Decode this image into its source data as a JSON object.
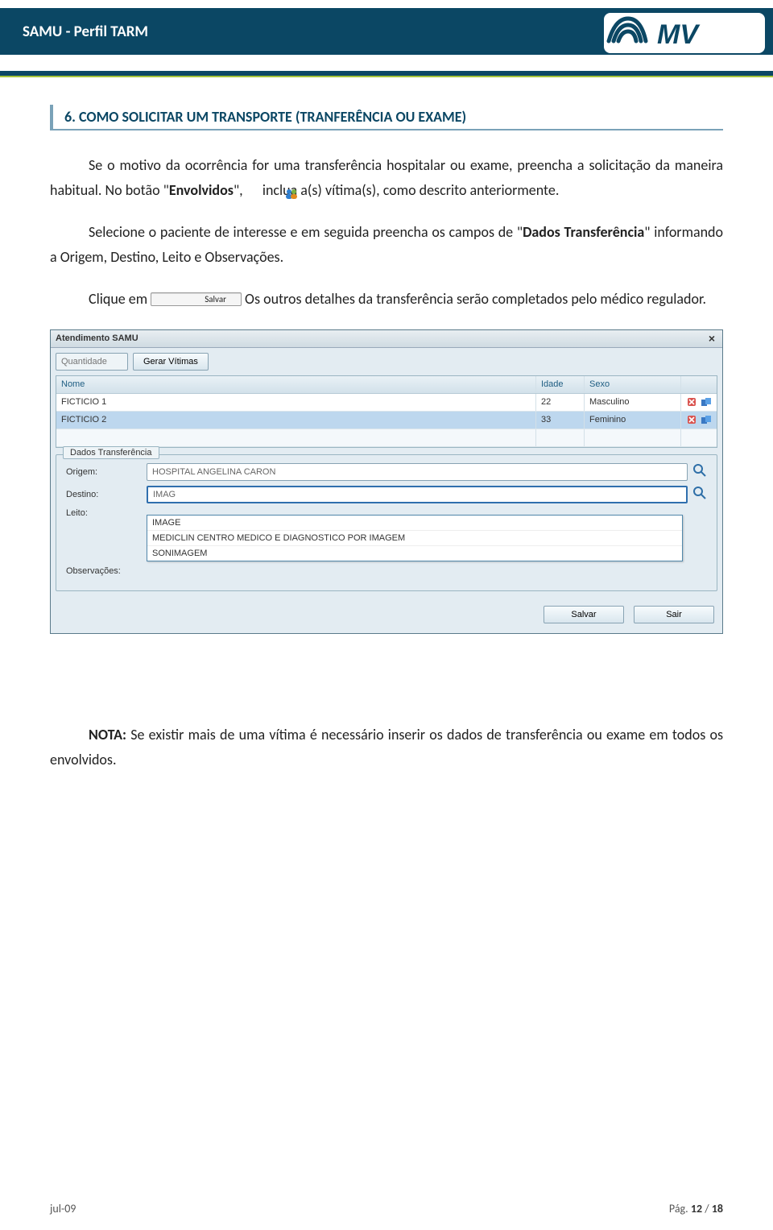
{
  "header": {
    "title": "SAMU  - Perfil TARM",
    "logo_text": "MV"
  },
  "section": {
    "heading": "6.   COMO SOLICITAR UM TRANSPORTE (TRANFERÊNCIA OU EXAME)"
  },
  "para": {
    "p1a": "Se o motivo da ocorrência for uma transferência hospitalar ou exame, preencha a solicitação da maneira habitual. No botão \"",
    "p1b": "Envolvidos",
    "p1c": "\", ",
    "p1d": " inclua a(s) vítima(s), como descrito anteriormente.",
    "p2a": "Selecione o paciente de interesse e em seguida preencha os campos de \"",
    "p2b": "Dados Transferência",
    "p2c": "\" informando a Origem, Destino, Leito e Observações.",
    "p3a": "Clique em ",
    "p3_btn": "Salvar",
    "p3b": " Os outros detalhes da transferência serão completados pelo médico regulador."
  },
  "app": {
    "title": "Atendimento SAMU",
    "toolbar": {
      "quantidade_ph": "Quantidade",
      "gerar_label": "Gerar Vítimas"
    },
    "grid": {
      "head": {
        "nome": "Nome",
        "idade": "Idade",
        "sexo": "Sexo"
      },
      "rows": [
        {
          "nome": "FICTICIO 1",
          "idade": "22",
          "sexo": "Masculino"
        },
        {
          "nome": "FICTICIO 2",
          "idade": "33",
          "sexo": "Feminino"
        }
      ]
    },
    "fieldset": {
      "legend": "Dados Transferência",
      "origem_label": "Origem:",
      "destino_label": "Destino:",
      "leito_label": "Leito:",
      "obs_label": "Observações:",
      "origem_value": "HOSPITAL ANGELINA CARON",
      "destino_value": "IMAG",
      "dropdown": [
        "IMAGE",
        "MEDICLIN CENTRO MEDICO E DIAGNOSTICO POR IMAGEM",
        "SONIMAGEM"
      ]
    },
    "buttons": {
      "salvar": "Salvar",
      "sair": "Sair"
    }
  },
  "nota": {
    "label": "NOTA:",
    "text": " Se existir mais de uma vítima é necessário inserir os dados de transferência ou exame em todos os envolvidos."
  },
  "footer": {
    "left": "jul-09",
    "right_prefix": "Pág. ",
    "page": "12",
    "sep": " / ",
    "total": "18"
  }
}
